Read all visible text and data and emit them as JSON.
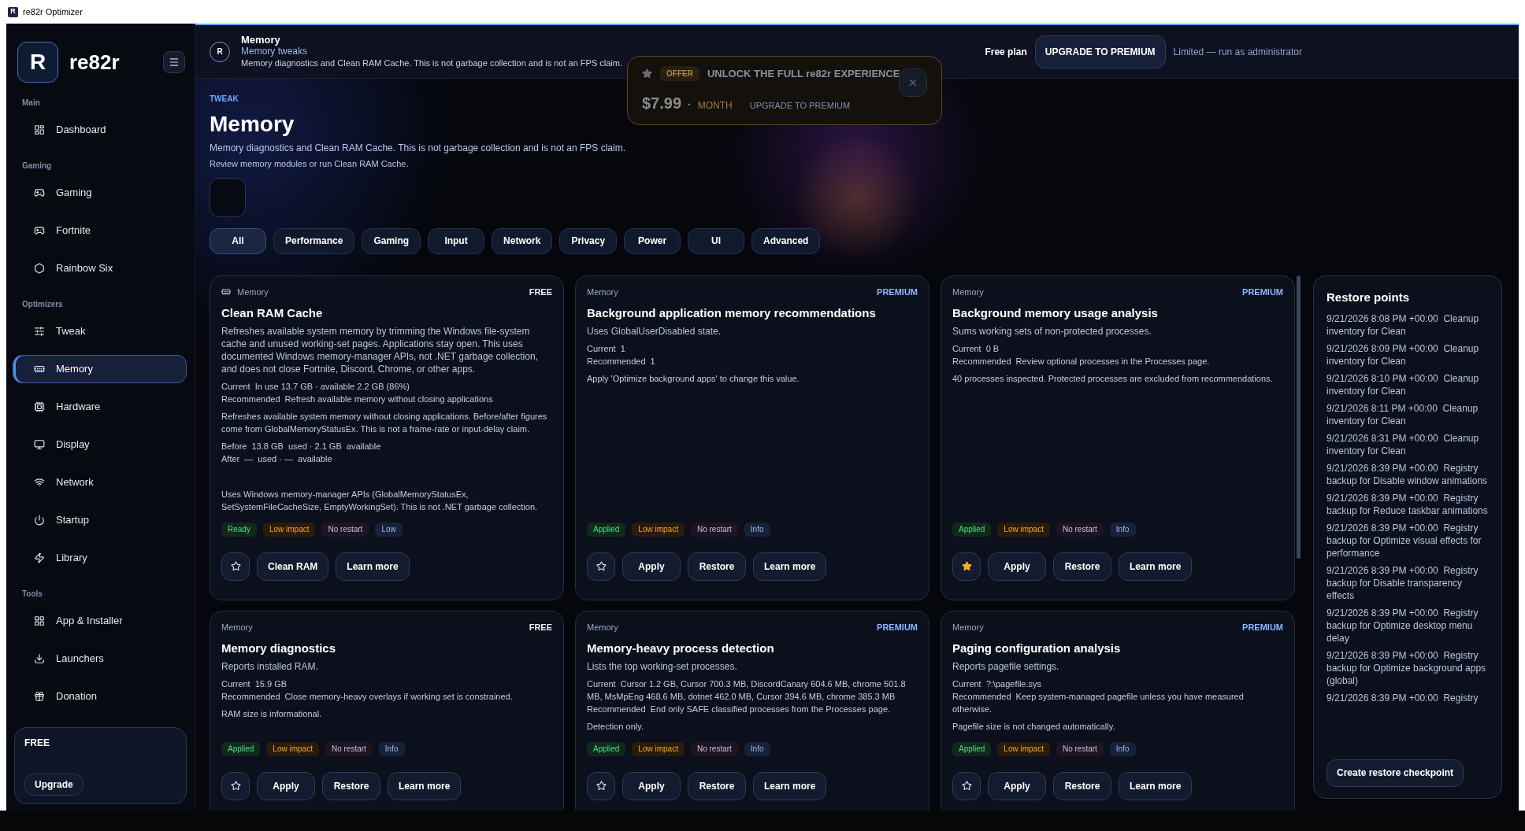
{
  "window": {
    "logo": "R",
    "title": "re82r Optimizer"
  },
  "sidebar": {
    "logo": "R",
    "brand": "re82r",
    "sections": [
      {
        "title": "Main",
        "items": [
          {
            "label": "Dashboard",
            "selected": false
          }
        ]
      },
      {
        "title": "Gaming",
        "items": [
          {
            "label": "Gaming",
            "selected": false
          },
          {
            "label": "Fortnite",
            "selected": false
          },
          {
            "label": "Rainbow Six",
            "selected": false
          }
        ]
      },
      {
        "title": "Optimizers",
        "items": [
          {
            "label": "Tweak",
            "selected": false
          },
          {
            "label": "Memory",
            "selected": true
          },
          {
            "label": "Hardware",
            "selected": false
          },
          {
            "label": "Display",
            "selected": false
          },
          {
            "label": "Network",
            "selected": false
          },
          {
            "label": "Startup",
            "selected": false
          },
          {
            "label": "Library",
            "selected": false
          }
        ]
      },
      {
        "title": "Tools",
        "items": [
          {
            "label": "App & Installer",
            "selected": false
          },
          {
            "label": "Launchers",
            "selected": false
          },
          {
            "label": "Donation",
            "selected": false
          }
        ]
      }
    ],
    "plan": {
      "label": "FREE",
      "button": "Upgrade"
    }
  },
  "header": {
    "avatar": "R",
    "title": "Memory",
    "subtitle": "Memory tweaks",
    "description": "Memory diagnostics and Clean RAM Cache. This is not garbage collection and is not an FPS claim.",
    "plan": "Free plan",
    "upgrade_button": "UPGRADE TO PREMIUM",
    "status": "Limited — run as administrator"
  },
  "offer": {
    "badge": "OFFER",
    "title": "UNLOCK THE FULL re82r EXPERIENCE",
    "price": "$7.99",
    "separator": "·",
    "period": "MONTH",
    "cta": "UPGRADE TO PREMIUM"
  },
  "page": {
    "eyebrow": "TWEAK",
    "title": "Memory",
    "description": "Memory diagnostics and Clean RAM Cache. This is not garbage collection and is not an FPS claim.",
    "hint": "Review memory modules or run Clean RAM Cache."
  },
  "filters": [
    {
      "label": "All",
      "selected": true
    },
    {
      "label": "Performance",
      "selected": false
    },
    {
      "label": "Gaming",
      "selected": false
    },
    {
      "label": "Input",
      "selected": false
    },
    {
      "label": "Network",
      "selected": false
    },
    {
      "label": "Privacy",
      "selected": false
    },
    {
      "label": "Power",
      "selected": false
    },
    {
      "label": "UI",
      "selected": false
    },
    {
      "label": "Advanced",
      "selected": false
    }
  ],
  "cards": [
    {
      "show_icon": true,
      "category": "Memory",
      "tier": "FREE",
      "premium": false,
      "title": "Clean RAM Cache",
      "description": "Refreshes available system memory by trimming the Windows file-system cache and unused working-set pages. Applications stay open. This uses documented Windows memory-manager APIs, not .NET garbage collection, and does not close Fortnite, Discord, Chrome, or other apps.",
      "groups": [
        [
          {
            "label": "Current",
            "value": "In use 13.7 GB · available 2.2 GB (86%)"
          },
          {
            "label": "Recommended",
            "value": "Refresh available memory without closing applications"
          }
        ],
        [
          {
            "value": "Refreshes available system memory without closing applications. Before/after figures come from GlobalMemoryStatusEx. This is not a frame-rate or input-delay claim."
          }
        ],
        [
          {
            "label": "Before",
            "value": "13.8 GB  used · 2.1 GB  available"
          },
          {
            "label": "After",
            "value": "—  used · —  available"
          }
        ]
      ],
      "note": "Uses Windows memory-manager APIs (GlobalMemoryStatusEx, SetSystemFileCacheSize, EmptyWorkingSet). This is not .NET garbage collection.",
      "tags": [
        {
          "kind": "status",
          "label": "Ready"
        },
        {
          "kind": "impact",
          "label": "Low impact"
        },
        {
          "kind": "restart",
          "label": "No restart"
        },
        {
          "kind": "level",
          "label": "Low"
        }
      ],
      "starred": false,
      "actions": [
        "Clean RAM",
        "Learn more"
      ]
    },
    {
      "show_icon": false,
      "category": "Memory",
      "tier": "PREMIUM",
      "premium": true,
      "title": "Background application memory recommendations",
      "description": "Uses GlobalUserDisabled state.",
      "groups": [
        [
          {
            "label": "Current",
            "value": "1"
          },
          {
            "label": "Recommended",
            "value": "1"
          }
        ],
        [
          {
            "value": "Apply 'Optimize background apps' to change this value."
          }
        ]
      ],
      "tags": [
        {
          "kind": "status",
          "label": "Applied"
        },
        {
          "kind": "impact",
          "label": "Low impact"
        },
        {
          "kind": "restart",
          "label": "No restart"
        },
        {
          "kind": "level",
          "label": "Info"
        }
      ],
      "starred": false,
      "actions": [
        "Apply",
        "Restore",
        "Learn more"
      ]
    },
    {
      "show_icon": false,
      "category": "Memory",
      "tier": "PREMIUM",
      "premium": true,
      "title": "Background memory usage analysis",
      "description": "Sums working sets of non-protected processes.",
      "groups": [
        [
          {
            "label": "Current",
            "value": "0 B"
          },
          {
            "label": "Recommended",
            "value": "Review optional processes in the Processes page."
          }
        ],
        [
          {
            "value": "40 processes inspected. Protected processes are excluded from recommendations."
          }
        ]
      ],
      "tags": [
        {
          "kind": "status",
          "label": "Applied"
        },
        {
          "kind": "impact",
          "label": "Low impact"
        },
        {
          "kind": "restart",
          "label": "No restart"
        },
        {
          "kind": "level",
          "label": "Info"
        }
      ],
      "starred": true,
      "actions": [
        "Apply",
        "Restore",
        "Learn more"
      ]
    },
    {
      "show_icon": false,
      "category": "Memory",
      "tier": "FREE",
      "premium": false,
      "title": "Memory diagnostics",
      "description": "Reports installed RAM.",
      "groups": [
        [
          {
            "label": "Current",
            "value": "15.9 GB"
          },
          {
            "label": "Recommended",
            "value": "Close memory-heavy overlays if working set is constrained."
          }
        ],
        [
          {
            "value": "RAM size is informational."
          }
        ]
      ],
      "tags": [
        {
          "kind": "status",
          "label": "Applied"
        },
        {
          "kind": "impact",
          "label": "Low impact"
        },
        {
          "kind": "restart",
          "label": "No restart"
        },
        {
          "kind": "level",
          "label": "Info"
        }
      ],
      "starred": false,
      "actions": [
        "Apply",
        "Restore",
        "Learn more"
      ]
    },
    {
      "show_icon": false,
      "category": "Memory",
      "tier": "PREMIUM",
      "premium": true,
      "title": "Memory-heavy process detection",
      "description": "Lists the top working-set processes.",
      "groups": [
        [
          {
            "label": "Current",
            "value": "Cursor 1.2 GB, Cursor 700.3 MB, DiscordCanary 604.6 MB, chrome 501.8 MB, MsMpEng 468.6 MB, dotnet 462.0 MB, Cursor 394.6 MB, chrome 385.3 MB"
          },
          {
            "label": "Recommended",
            "value": "End only SAFE classified processes from the Processes page."
          }
        ],
        [
          {
            "value": "Detection only."
          }
        ]
      ],
      "tags": [
        {
          "kind": "status",
          "label": "Applied"
        },
        {
          "kind": "impact",
          "label": "Low impact"
        },
        {
          "kind": "restart",
          "label": "No restart"
        },
        {
          "kind": "level",
          "label": "Info"
        }
      ],
      "starred": false,
      "actions": [
        "Apply",
        "Restore",
        "Learn more"
      ]
    },
    {
      "show_icon": false,
      "category": "Memory",
      "tier": "PREMIUM",
      "premium": true,
      "title": "Paging configuration analysis",
      "description": "Reports pagefile settings.",
      "groups": [
        [
          {
            "label": "Current",
            "value": "?:\\pagefile.sys"
          },
          {
            "label": "Recommended",
            "value": "Keep system-managed pagefile unless you have measured otherwise."
          }
        ],
        [
          {
            "value": "Pagefile size is not changed automatically."
          }
        ]
      ],
      "tags": [
        {
          "kind": "status",
          "label": "Applied"
        },
        {
          "kind": "impact",
          "label": "Low impact"
        },
        {
          "kind": "restart",
          "label": "No restart"
        },
        {
          "kind": "level",
          "label": "Info"
        }
      ],
      "starred": false,
      "actions": [
        "Apply",
        "Restore",
        "Learn more"
      ]
    }
  ],
  "restore_points": {
    "title": "Restore points",
    "items": [
      "9/21/2026 8:08 PM +00:00  Cleanup inventory for Clean",
      "9/21/2026 8:09 PM +00:00  Cleanup inventory for Clean",
      "9/21/2026 8:10 PM +00:00  Cleanup inventory for Clean",
      "9/21/2026 8:11 PM +00:00  Cleanup inventory for Clean",
      "9/21/2026 8:31 PM +00:00  Cleanup inventory for Clean",
      "9/21/2026 8:39 PM +00:00  Registry backup for Disable window animations",
      "9/21/2026 8:39 PM +00:00  Registry backup for Reduce taskbar animations",
      "9/21/2026 8:39 PM +00:00  Registry backup for Optimize visual effects for performance",
      "9/21/2026 8:39 PM +00:00  Registry backup for Disable transparency effects",
      "9/21/2026 8:39 PM +00:00  Registry backup for Optimize desktop menu delay",
      "9/21/2026 8:39 PM +00:00  Registry backup for Optimize background apps (global)",
      "9/21/2026 8:39 PM +00:00  Registry"
    ],
    "button": "Create restore checkpoint"
  }
}
